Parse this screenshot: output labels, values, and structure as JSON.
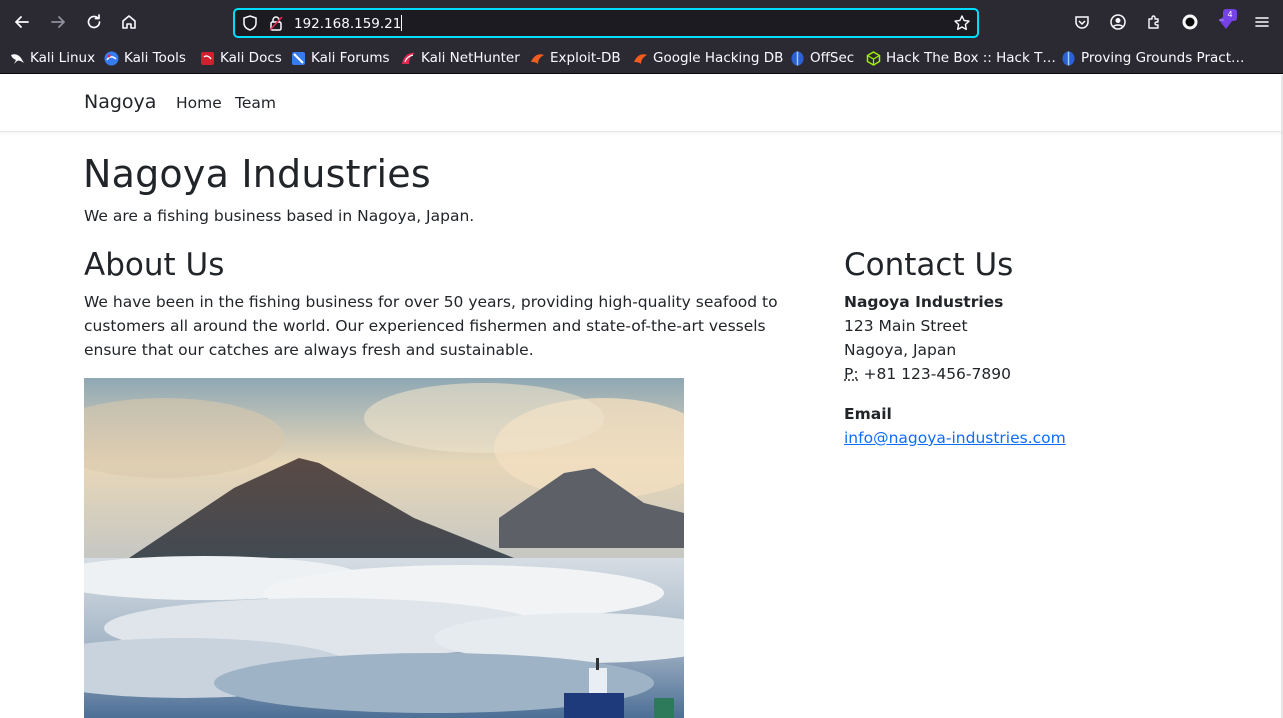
{
  "browser": {
    "url": "192.168.159.21",
    "badge_count": "4",
    "bookmarks": [
      {
        "label": "Kali Linux",
        "icon": "kali-dragon-icon"
      },
      {
        "label": "Kali Tools",
        "icon": "kali-tools-icon"
      },
      {
        "label": "Kali Docs",
        "icon": "kali-docs-icon"
      },
      {
        "label": "Kali Forums",
        "icon": "kali-forums-icon"
      },
      {
        "label": "Kali NetHunter",
        "icon": "kali-nethunter-icon"
      },
      {
        "label": "Exploit-DB",
        "icon": "exploit-db-icon"
      },
      {
        "label": "Google Hacking DB",
        "icon": "ghdb-icon"
      },
      {
        "label": "OffSec",
        "icon": "offsec-icon"
      },
      {
        "label": "Hack The Box :: Hack T…",
        "icon": "hackthebox-icon"
      },
      {
        "label": "Proving Grounds Pract…",
        "icon": "proving-grounds-icon"
      }
    ],
    "colors": {
      "chrome_bg": "#2b2a33",
      "url_bg": "#1c1b22",
      "focus_ring": "#00ddff"
    }
  },
  "site": {
    "brand": "Nagoya",
    "nav": [
      "Home",
      "Team"
    ],
    "title": "Nagoya Industries",
    "lead": "We are a fishing business based in Nagoya, Japan.",
    "about": {
      "heading": "About Us",
      "text": "We have been in the fishing business for over 50 years, providing high-quality seafood to customers all around the world. Our experienced fishermen and state-of-the-art vessels ensure that our catches are always fresh and sustainable."
    },
    "contact": {
      "heading": "Contact Us",
      "company": "Nagoya Industries",
      "street": "123 Main Street",
      "city": "Nagoya, Japan",
      "phone_abbr": "P:",
      "phone": "+81 123-456-7890",
      "email_heading": "Email",
      "email": "info@nagoya-industries.com"
    },
    "colors": {
      "text": "#212529",
      "link": "#0d6efd"
    }
  }
}
